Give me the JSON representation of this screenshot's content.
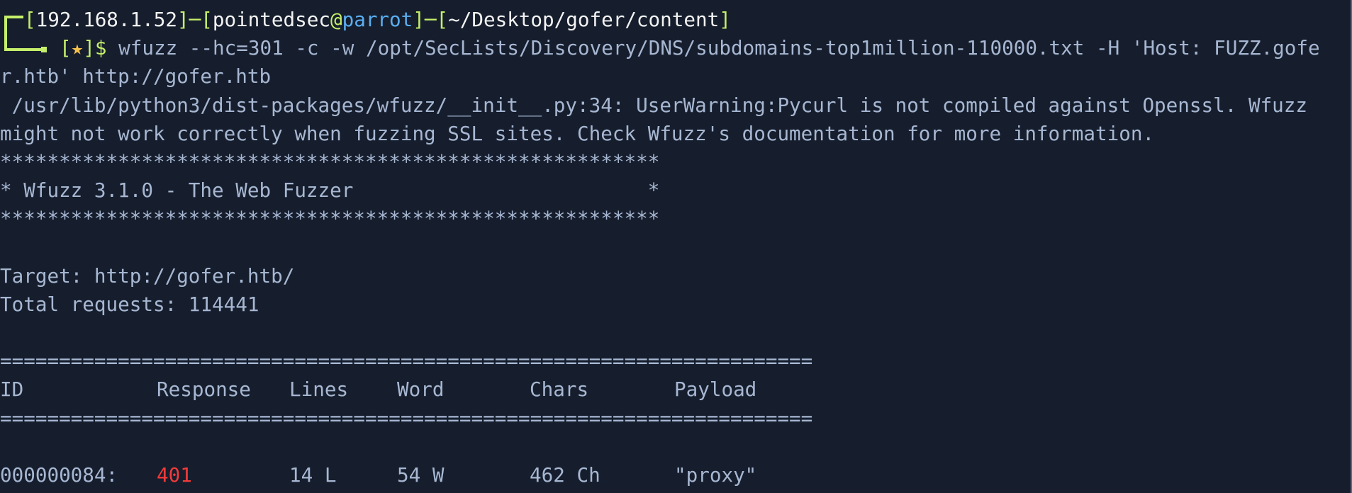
{
  "terminal": {
    "prompt": {
      "ip": "192.168.1.52",
      "user": "pointedsec",
      "at": "@",
      "host": "parrot",
      "cwd": "~/Desktop/gofer/content",
      "indicator": "★",
      "symbol": "$",
      "command_line1": "wfuzz --hc=301 -c -w /opt/SecLists/Discovery/DNS/subdomains-top1million-110000.txt -H 'Host: FUZZ.gofe",
      "command_line2": "r.htb' http://gofer.htb"
    },
    "output": {
      "warning_line1": " /usr/lib/python3/dist-packages/wfuzz/__init__.py:34: UserWarning:Pycurl is not compiled against Openssl. Wfuzz",
      "warning_line2": "might not work correctly when fuzzing SSL sites. Check Wfuzz's documentation for more information.",
      "banner_border": "********************************************************",
      "banner_text": "* Wfuzz 3.1.0 - The Web Fuzzer                         *",
      "target_line": "Target: http://gofer.htb/",
      "total_requests_line": "Total requests: 114441",
      "separator": "=====================================================================",
      "table": {
        "headers": {
          "id": "ID",
          "response": "Response",
          "lines": "Lines",
          "word": "Word",
          "chars": "Chars",
          "payload": "Payload"
        },
        "rows": [
          {
            "id": "000000084:",
            "response": "401",
            "lines": "14 L",
            "word": "54 W",
            "chars": "462 Ch",
            "payload": "\"proxy\""
          }
        ]
      }
    },
    "colors": {
      "background": "#161e2d",
      "text": "#a7b7d2",
      "prompt_bracket": "#c5ef6a",
      "host": "#5aaef0",
      "status_401": "#f43a3a",
      "star": "#f5c14a"
    }
  }
}
